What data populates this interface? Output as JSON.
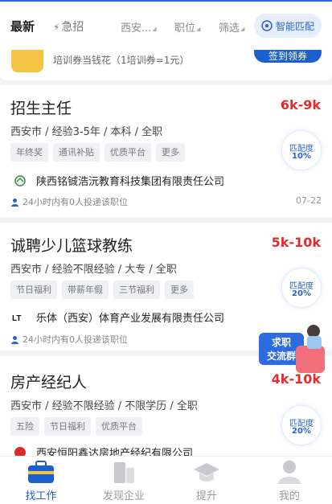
{
  "header": {
    "tabs": [
      "最新",
      "急招"
    ],
    "filters": [
      "西安...",
      "职位",
      "筛选"
    ],
    "smart_match": "智能匹配"
  },
  "banner": {
    "text": "培训券当钱花（1培训券=1元）",
    "button": "签到领券"
  },
  "jobs": [
    {
      "title": "招生主任",
      "salary": "6k-9k",
      "meta": "西安市 / 经验3-5年 / 本科 / 全职",
      "tags": [
        "年终奖",
        "通讯补贴",
        "优质平台",
        "更多"
      ],
      "match_label": "匹配度",
      "match": "10%",
      "company": "陕西铭铖浩沅教育科技集团有限责任公司",
      "hint": "24小时内有0人投递该职位",
      "date": "07-22"
    },
    {
      "title": "诚聘少儿篮球教练",
      "salary": "5k-10k",
      "meta": "西安市 / 经验不限经验 / 大专 / 全职",
      "tags": [
        "节日福利",
        "带薪年假",
        "三节福利",
        "更多"
      ],
      "match_label": "匹配度",
      "match": "20%",
      "company": "乐体（西安）体育产业发展有限责任公司",
      "hint": "24小时内有0人投递该职位",
      "date": ""
    },
    {
      "title": "房产经纪人",
      "salary": "4k-10k",
      "meta": "西安市 / 经验不限经验 / 不限学历 / 全职",
      "tags": [
        "五险",
        "节日福利",
        "优质平台"
      ],
      "match_label": "匹配度",
      "match": "20%",
      "company": "西安恒阳鑫达房地产经纪有限公司"
    }
  ],
  "float_badge": {
    "line1": "求职",
    "line2": "交流群"
  },
  "nav": [
    {
      "label": "找工作",
      "icon": "briefcase-icon",
      "active": true
    },
    {
      "label": "发现企业",
      "icon": "building-icon",
      "active": false
    },
    {
      "label": "提升",
      "icon": "graduation-cap-icon",
      "active": false
    },
    {
      "label": "我的",
      "icon": "user-icon",
      "active": false
    }
  ],
  "colors": {
    "accent": "#1c5fcf",
    "salary": "#e02c2c",
    "tag_bg": "#eef0f3"
  }
}
